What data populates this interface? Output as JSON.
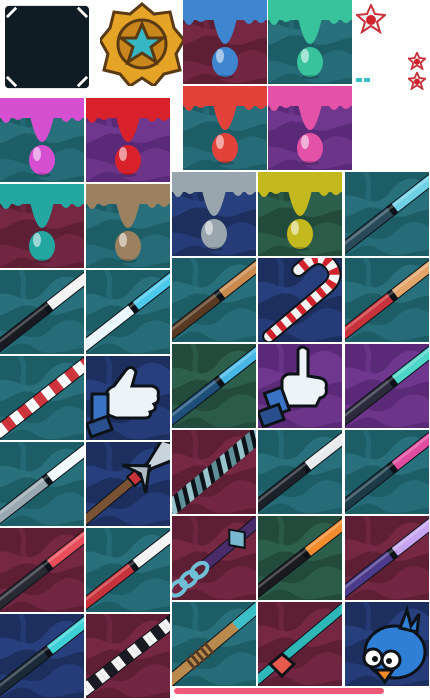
{
  "sheet": {
    "colors": {
      "teal_bg": "#1d5d66",
      "teal_pattern": "#2a7380",
      "purple_bg": "#5a2a78",
      "purple_pattern": "#733a92",
      "maroon_bg": "#5e1f34",
      "maroon_pattern": "#7a2a47",
      "navy_bg": "#1c2f5e",
      "navy_pattern": "#2a4283",
      "olive_bg": "#234b3b",
      "olive_pattern": "#2e6450",
      "gold": "#e6a426",
      "dark_frame": "#0f1c24"
    },
    "icons": [
      {
        "name": "dark-frame",
        "kind": "frame"
      },
      {
        "name": "star-medal",
        "kind": "medal"
      },
      {
        "name": "blue-drip",
        "kind": "drip",
        "color": "#3e86cf",
        "bg": "maroon"
      },
      {
        "name": "green-drip",
        "kind": "drip",
        "color": "#39c39c",
        "bg": "teal"
      },
      {
        "name": "magenta-drip",
        "kind": "drip",
        "color": "#d64fd0",
        "bg": "teal"
      },
      {
        "name": "red-drip",
        "kind": "drip",
        "color": "#d9212c",
        "bg": "purple"
      },
      {
        "name": "coral-drip",
        "kind": "drip",
        "color": "#e2423a",
        "bg": "teal"
      },
      {
        "name": "pink-drip",
        "kind": "drip",
        "color": "#e352a7",
        "bg": "purple"
      },
      {
        "name": "teal-drip",
        "kind": "drip",
        "color": "#23a7a0",
        "bg": "maroon"
      },
      {
        "name": "brown-drip",
        "kind": "drip",
        "color": "#9c8160",
        "bg": "teal"
      },
      {
        "name": "grey-drip",
        "kind": "drip",
        "color": "#9aa6ad",
        "bg": "navy"
      },
      {
        "name": "olive-drip",
        "kind": "drip",
        "color": "#c4b81f",
        "bg": "olive"
      },
      {
        "name": "dark-cue",
        "kind": "cue",
        "bg": "teal",
        "c1": "#2a4a5a",
        "c2": "#6fd0e4"
      },
      {
        "name": "black-white-cue",
        "kind": "cue",
        "bg": "teal",
        "c1": "#1a1a22",
        "c2": "#f2f2f2"
      },
      {
        "name": "cyan-white-cue",
        "kind": "cue",
        "bg": "teal",
        "c1": "#e9f6fb",
        "c2": "#4cc9ec"
      },
      {
        "name": "wood-cue",
        "kind": "cue",
        "bg": "teal",
        "c1": "#5a3a22",
        "c2": "#c88a4d"
      },
      {
        "name": "candy-cane-cue",
        "kind": "candy",
        "bg": "navy"
      },
      {
        "name": "red-wood-cue",
        "kind": "cue",
        "bg": "teal",
        "c1": "#c8323a",
        "c2": "#e4a56b"
      },
      {
        "name": "red-stripe-cue",
        "kind": "stripe",
        "bg": "teal",
        "c1": "#d0343c",
        "c2": "#ffffff"
      },
      {
        "name": "thumbs-up-icon",
        "kind": "thumb",
        "bg": "navy"
      },
      {
        "name": "blue-cue",
        "kind": "cue",
        "bg": "olive",
        "c1": "#1d4f7a",
        "c2": "#47b8e6"
      },
      {
        "name": "pointing-hand-icon",
        "kind": "point",
        "bg": "purple"
      },
      {
        "name": "teal-purple-cue",
        "kind": "cue",
        "bg": "purple",
        "c1": "#2b2b3d",
        "c2": "#4ed6c9"
      },
      {
        "name": "silver-cue",
        "kind": "cue",
        "bg": "teal",
        "c1": "#9aa8b2",
        "c2": "#f4fbff"
      },
      {
        "name": "ornate-spear-cue",
        "kind": "spear",
        "bg": "navy"
      },
      {
        "name": "twisted-cue",
        "kind": "twist",
        "bg": "maroon"
      },
      {
        "name": "diamond-cue",
        "kind": "cue",
        "bg": "teal",
        "c1": "#1d2129",
        "c2": "#e8eaec"
      },
      {
        "name": "pink-cue",
        "kind": "cue",
        "bg": "teal",
        "c1": "#1c3a48",
        "c2": "#e04ca0"
      },
      {
        "name": "magenta-dark-cue",
        "kind": "cue",
        "bg": "maroon",
        "c1": "#2a2a34",
        "c2": "#e84e5a"
      },
      {
        "name": "red-white-cue",
        "kind": "cue",
        "bg": "teal",
        "c1": "#c8323a",
        "c2": "#f3f3f3"
      },
      {
        "name": "chain-cue",
        "kind": "chain",
        "bg": "maroon"
      },
      {
        "name": "orange-cue",
        "kind": "cue",
        "bg": "olive",
        "c1": "#1a1a1f",
        "c2": "#f28c2c"
      },
      {
        "name": "lilac-cue",
        "kind": "cue",
        "bg": "maroon",
        "c1": "#4c3a8c",
        "c2": "#c7a4f0"
      },
      {
        "name": "turquoise-cue",
        "kind": "cue",
        "bg": "navy",
        "c1": "#1a2a36",
        "c2": "#3dd1d6"
      },
      {
        "name": "black-stripe-cue",
        "kind": "stripe",
        "bg": "maroon",
        "c1": "#1a1a22",
        "c2": "#f3f3f3"
      },
      {
        "name": "rope-cue",
        "kind": "rope",
        "bg": "teal"
      },
      {
        "name": "gem-spear-cue",
        "kind": "gem",
        "bg": "maroon"
      },
      {
        "name": "blue-bird-icon",
        "kind": "bird",
        "bg": "navy"
      }
    ]
  }
}
